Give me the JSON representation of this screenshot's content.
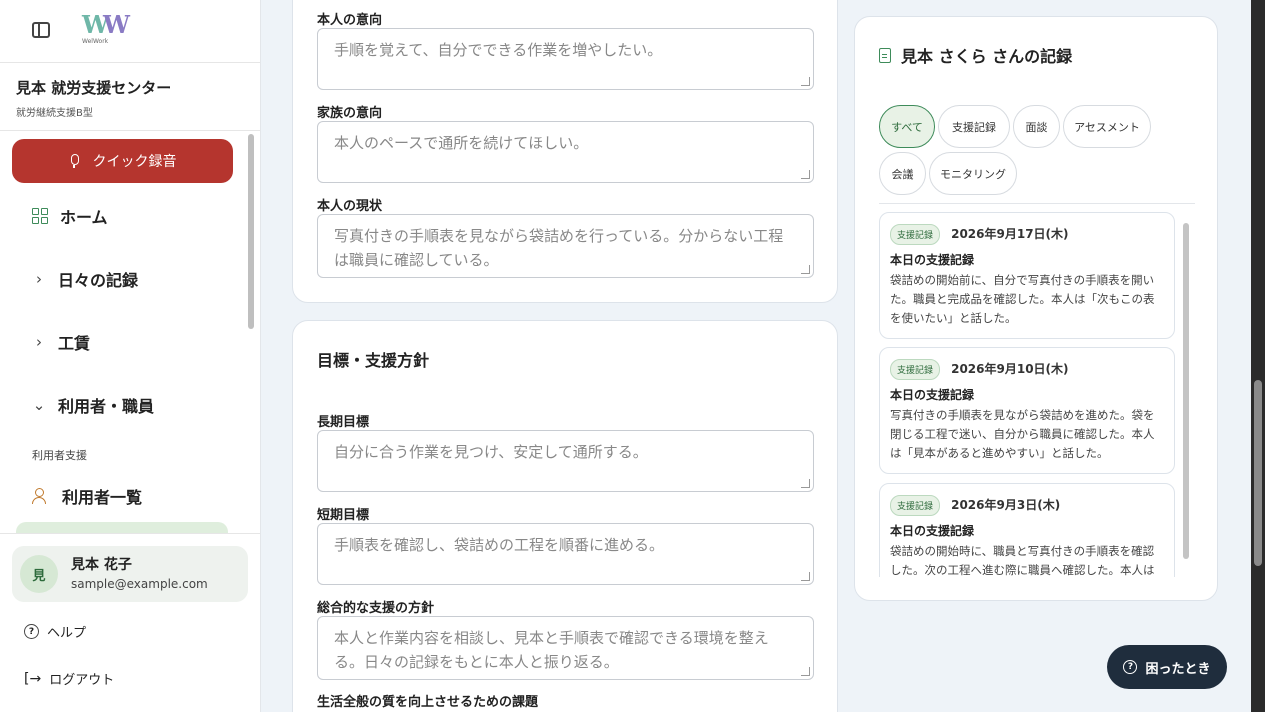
{
  "sidebar": {
    "logo_text": "WelWork",
    "org_name": "見本 就労支援センター",
    "org_type": "就労継続支援B型",
    "quick_record": "クイック録音",
    "nav": {
      "home": "ホーム",
      "daily_records": "日々の記録",
      "wages": "工賃",
      "users_staff": "利用者・職員",
      "user_support_label": "利用者支援",
      "user_list": "利用者一覧"
    },
    "user": {
      "initial": "見",
      "name": "見本 花子",
      "email": "sample@example.com"
    },
    "help": "ヘルプ",
    "logout": "ログアウト"
  },
  "form": {
    "intent_self_label": "本人の意向",
    "intent_self_value": "手順を覚えて、自分でできる作業を増やしたい。",
    "intent_family_label": "家族の意向",
    "intent_family_value": "本人のペースで通所を続けてほしい。",
    "current_label": "本人の現状",
    "current_value": "写真付きの手順表を見ながら袋詰めを行っている。分からない工程は職員に確認している。",
    "goals_title": "目標・支援方針",
    "long_goal_label": "長期目標",
    "long_goal_value": "自分に合う作業を見つけ、安定して通所する。",
    "short_goal_label": "短期目標",
    "short_goal_value": "手順表を確認し、袋詰めの工程を順番に進める。",
    "policy_label": "総合的な支援の方針",
    "policy_value": "本人と作業内容を相談し、見本と手順表で確認できる環境を整える。日々の記録をもとに本人と振り返る。",
    "life_quality_label": "生活全般の質を向上させるための課題"
  },
  "records_panel": {
    "title": "見本 さくら さんの記録",
    "filters": [
      "すべて",
      "支援記録",
      "面談",
      "アセスメント",
      "会議",
      "モニタリング"
    ],
    "active_filter": "すべて",
    "records": [
      {
        "tag": "支援記録",
        "date": "2026年9月17日(木)",
        "title": "本日の支援記録",
        "body": "袋詰めの開始前に、自分で写真付きの手順表を開いた。職員と完成品を確認した。本人は「次もこの表を使いたい」と話した。"
      },
      {
        "tag": "支援記録",
        "date": "2026年9月10日(木)",
        "title": "本日の支援記録",
        "body": "写真付きの手順表を見ながら袋詰めを進めた。袋を閉じる工程で迷い、自分から職員に確認した。本人は「見本があると進めやすい」と話した。"
      },
      {
        "tag": "支援記録",
        "date": "2026年9月3日(木)",
        "title": "本日の支援記録",
        "body": "袋詰めの開始時に、職員と写真付きの手順表を確認した。次の工程へ進む際に職員へ確認した。本人は"
      }
    ]
  },
  "help_button": "困ったとき",
  "colors": {
    "accent_red": "#b5352e",
    "accent_green": "#3e8b5a",
    "help_button_bg": "#1f2d3d"
  }
}
